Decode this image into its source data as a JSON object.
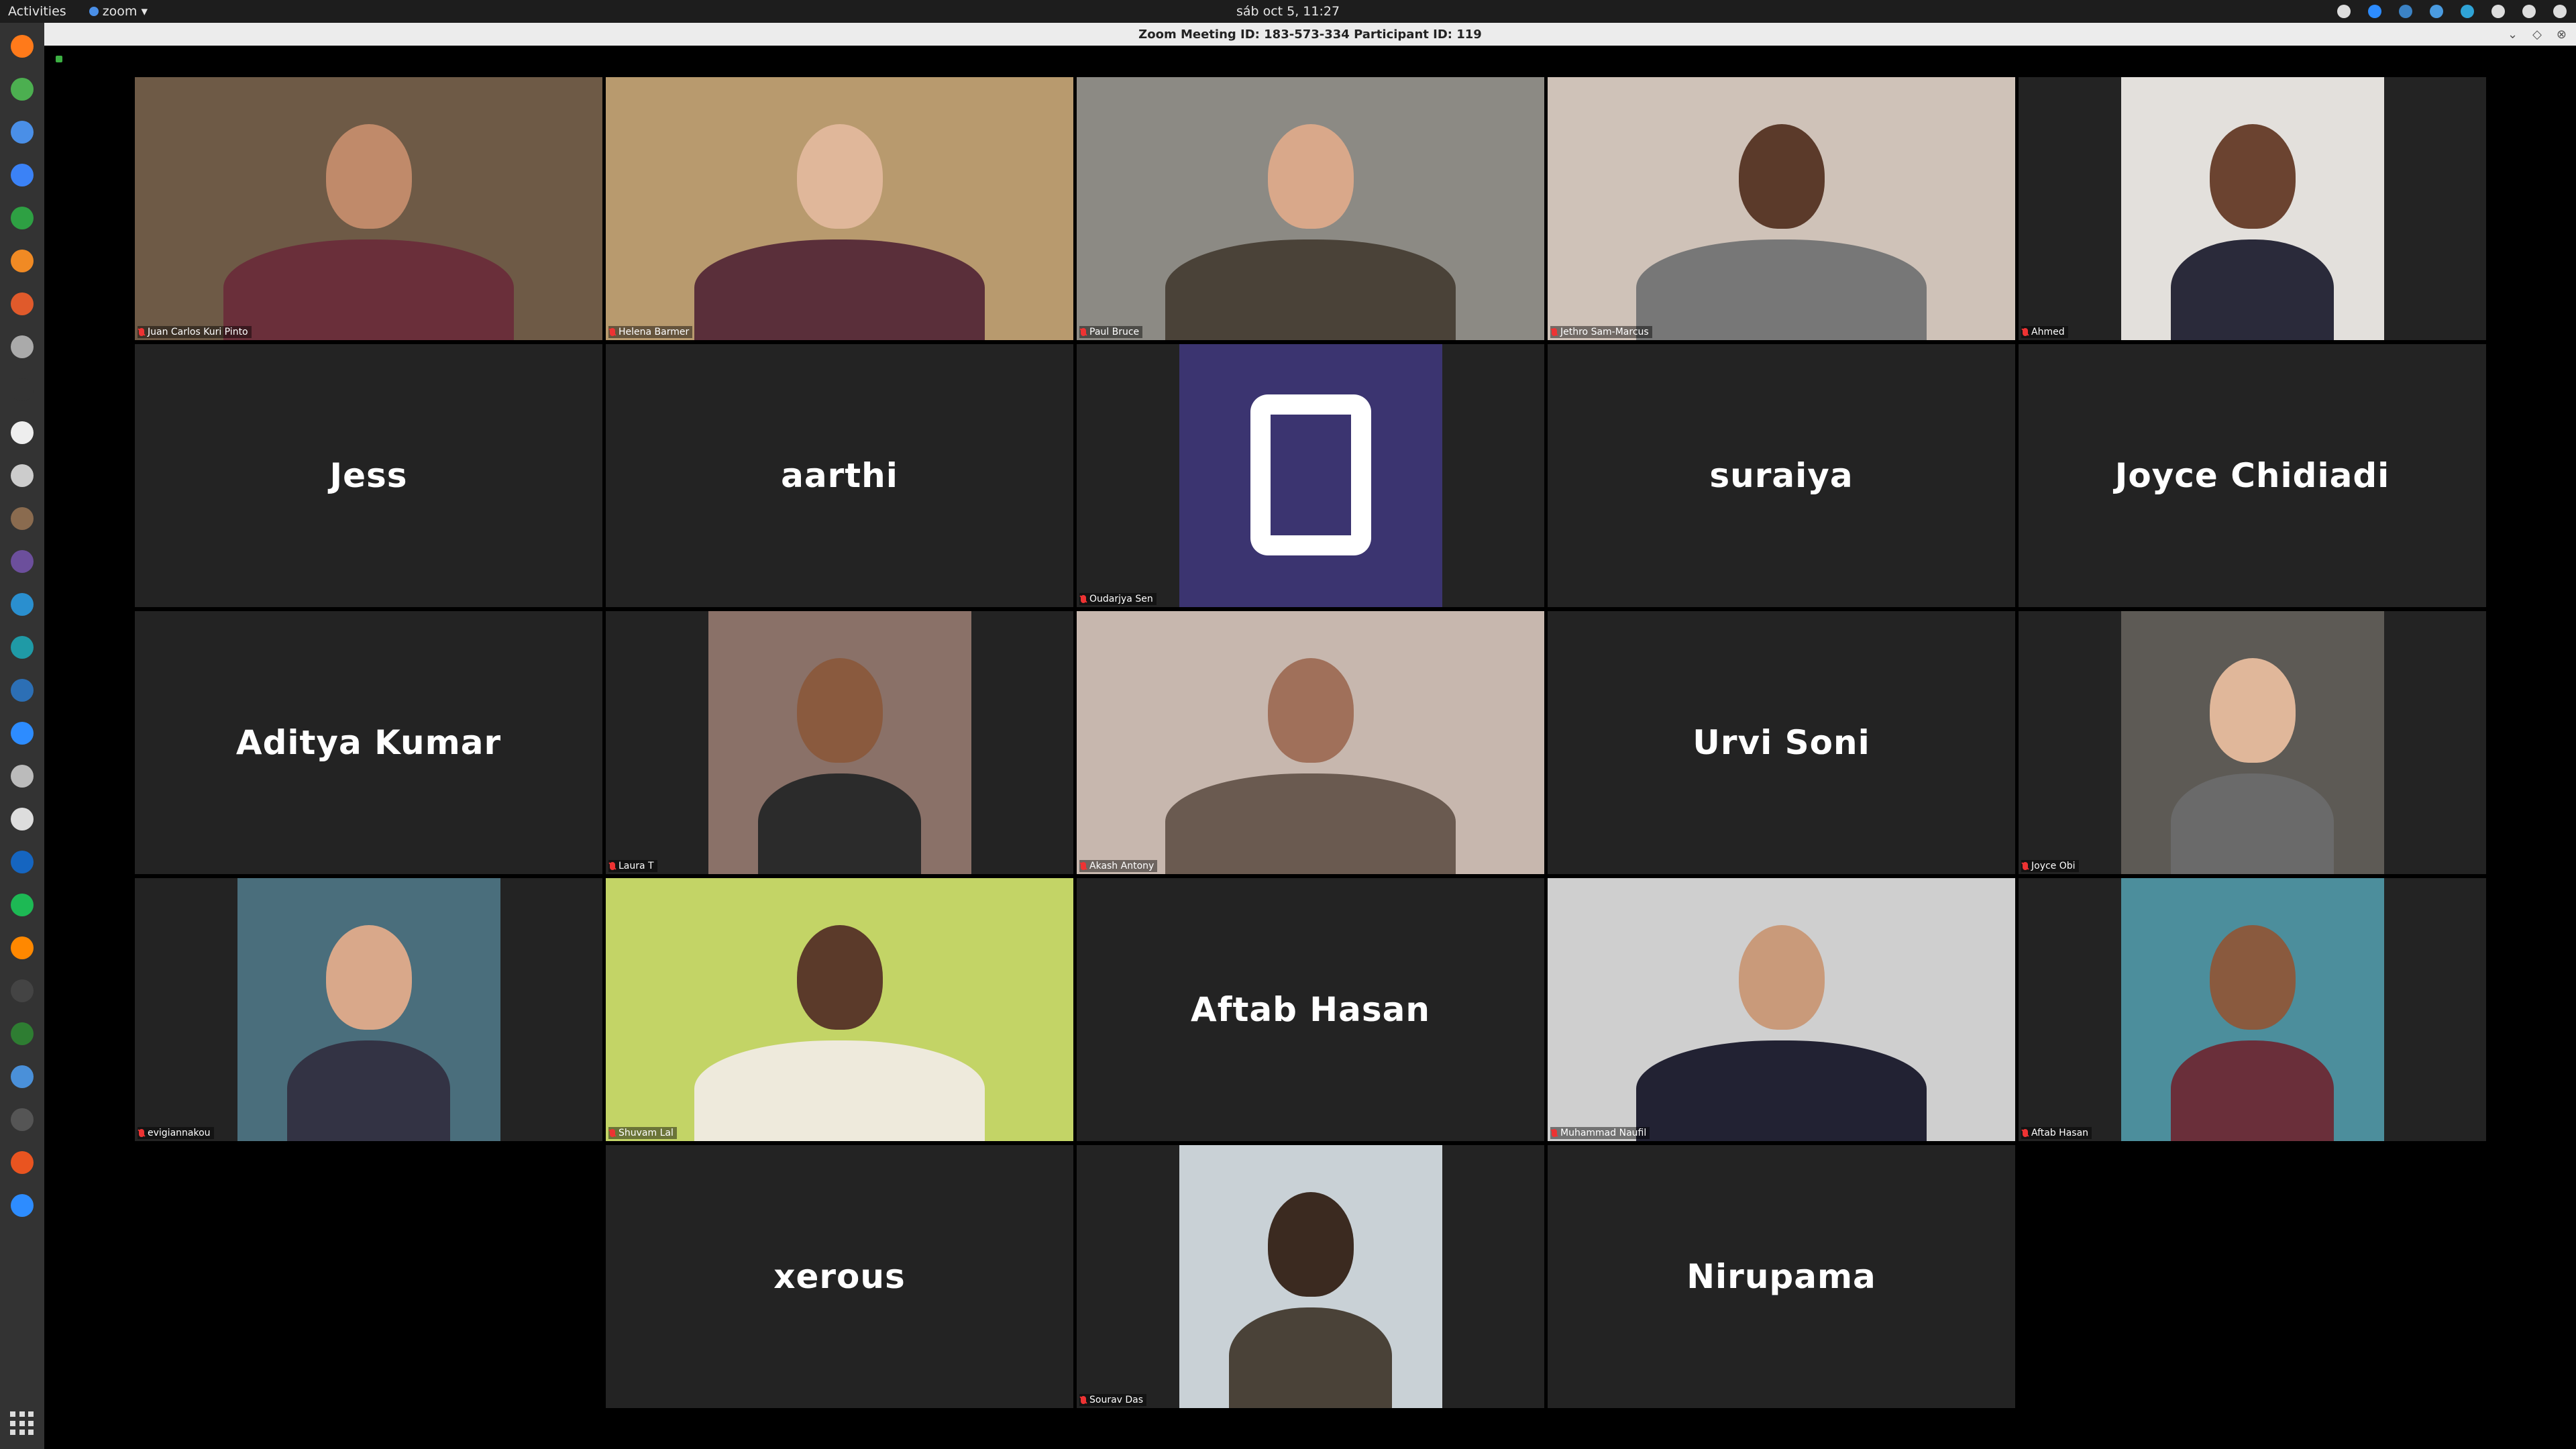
{
  "topbar": {
    "activities": "Activities",
    "app_menu": "zoom ▾",
    "clock": "sáb oct  5, 11:27"
  },
  "window": {
    "title": "Zoom Meeting ID: 183-573-334 Participant ID: 119"
  },
  "dock": {
    "apps": [
      "firefox-icon",
      "chrome-icon",
      "chromium-icon",
      "docs-icon",
      "sheets-icon",
      "slides-icon",
      "software-center-icon",
      "tools-icon",
      "terminal-icon",
      "text-editor-icon",
      "disc-icon",
      "gimp-icon",
      "video-editor-icon",
      "globe-icon",
      "arduino-icon",
      "inkscape-icon",
      "zoom-icon",
      "files-icon",
      "keyboard-icon",
      "virtualbox-icon",
      "spotify-icon",
      "vlc-icon",
      "screen-icon",
      "gnome-icon",
      "world-icon",
      "monitor-icon",
      "ubuntu-icon",
      "zoom-meeting-icon"
    ]
  },
  "tiles": [
    {
      "name": "Juan Carlos Kuri Pinto",
      "video": true,
      "bg": "#6e5a46"
    },
    {
      "name": "Helena Barmer",
      "video": true,
      "bg": "#b89a6e",
      "active": true
    },
    {
      "name": "Paul Bruce",
      "video": true,
      "bg": "#8c8a84"
    },
    {
      "name": "Jethro Sam-Marcus",
      "video": true,
      "bg": "#cfc2b8"
    },
    {
      "name": "Ahmed",
      "video": true,
      "bg": "#e3e0dc"
    },
    {
      "name": "Jess",
      "video": false
    },
    {
      "name": "aarthi",
      "video": false
    },
    {
      "name": "Oudarjya Sen",
      "video": true,
      "bg": "#3b3470"
    },
    {
      "name": "suraiya",
      "video": false
    },
    {
      "name": "Joyce Chidiadi",
      "video": false
    },
    {
      "name": "Aditya Kumar",
      "video": false
    },
    {
      "name": "Laura T",
      "video": true,
      "bg": "#8a7168"
    },
    {
      "name": "Akash Antony",
      "video": true,
      "bg": "#c7b7ae"
    },
    {
      "name": "Urvi Soni",
      "video": false
    },
    {
      "name": "Joyce Obi",
      "video": true,
      "bg": "#5d5a55"
    },
    {
      "name": "evigiannakou",
      "video": true,
      "bg": "#4a6e7c"
    },
    {
      "name": "Shuvam Lal",
      "video": true,
      "bg": "#c3d466"
    },
    {
      "name": "Aftab Hasan",
      "video": false
    },
    {
      "name": "Muhammad Naufil",
      "video": true,
      "bg": "#cfcfcf"
    },
    {
      "name": "Aftab Hasan",
      "video": true,
      "bg": "#4c8e9c"
    },
    {
      "name": "xerous",
      "video": false
    },
    {
      "name": "Sourav Das",
      "video": true,
      "bg": "#c9d1d6"
    },
    {
      "name": "Nirupama",
      "video": false
    }
  ]
}
